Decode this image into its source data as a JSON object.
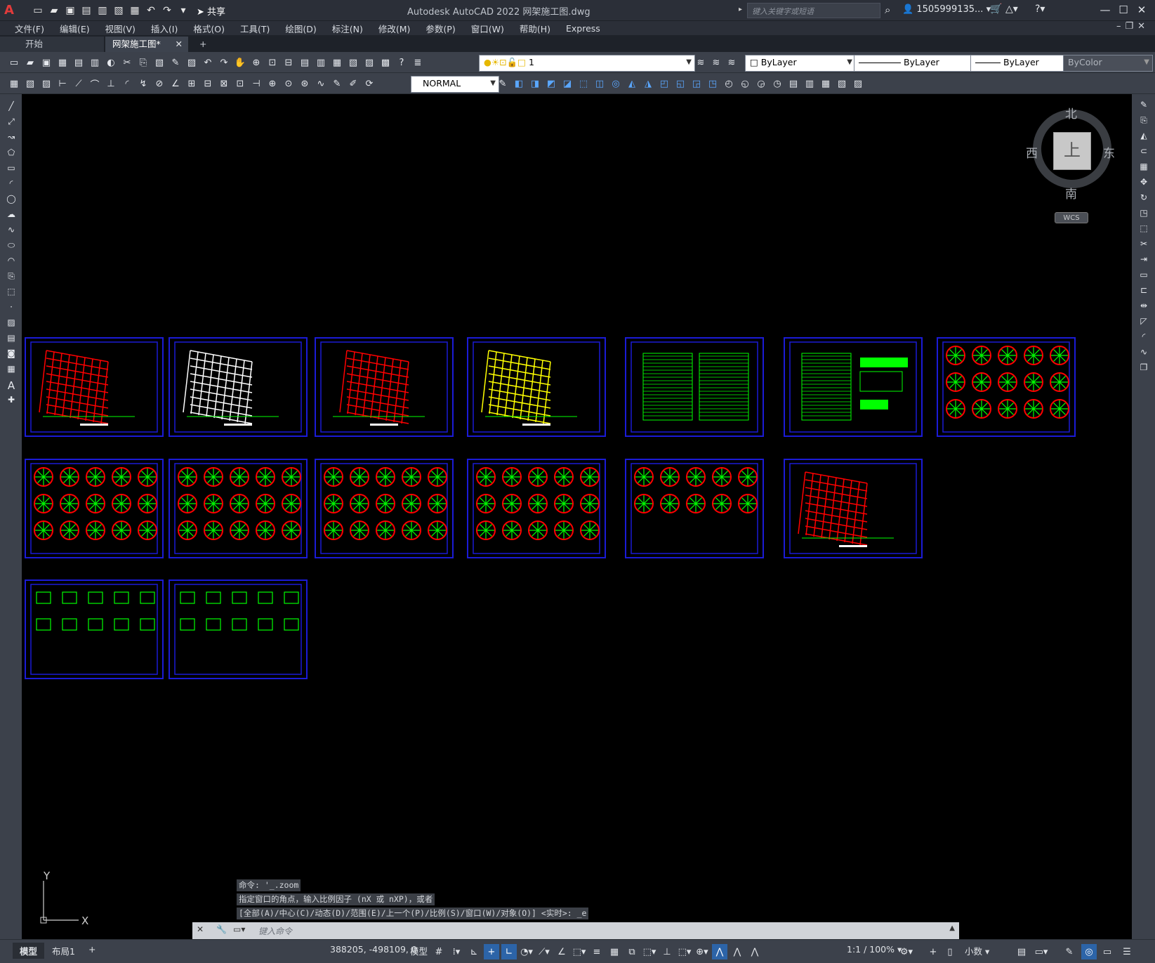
{
  "window": {
    "title": "Autodesk AutoCAD 2022    网架施工图.dwg",
    "search_placeholder": "键入关键字或短语",
    "user": "1505999135...",
    "logo": "A"
  },
  "quick_access": {
    "share_label": "共享",
    "icons": [
      "new-icon",
      "open-icon",
      "save-icon",
      "save-as-icon",
      "web-icon",
      "import-icon",
      "print-icon",
      "undo-icon",
      "redo-icon"
    ]
  },
  "menu": [
    "文件(F)",
    "编辑(E)",
    "视图(V)",
    "插入(I)",
    "格式(O)",
    "工具(T)",
    "绘图(D)",
    "标注(N)",
    "修改(M)",
    "参数(P)",
    "窗口(W)",
    "帮助(H)",
    "Express"
  ],
  "tabs": [
    {
      "label": "开始"
    },
    {
      "label": "网架施工图*",
      "close": "✕"
    },
    {
      "label": "+"
    }
  ],
  "properties": {
    "layer_value": "1",
    "color": "ByLayer",
    "linetype": "ByLayer",
    "lineweight": "ByLayer",
    "plotstyle": "ByColor",
    "dimstyle": "NORMAL"
  },
  "viewcube": {
    "north": "北",
    "south": "南",
    "east": "东",
    "west": "西",
    "face": "上",
    "wcs": "WCS"
  },
  "ucs": {
    "y": "Y",
    "x": "X"
  },
  "command_history": [
    "命令: '_.zoom",
    "指定窗口的角点，输入比例因子 (nX 或 nXP)，或者",
    "[全部(A)/中心(C)/动态(D)/范围(E)/上一个(P)/比例(S)/窗口(W)/对象(O)] <实时>: _e"
  ],
  "command_placeholder": "键入命令",
  "status": {
    "tab_model": "模型",
    "tab_layout": "布局1",
    "add_tab": "+",
    "coords": "388205, -498109, 0",
    "mode": "模型",
    "scale": "1:1 / 100%",
    "units": "小数"
  },
  "colors": {
    "sheet_border": "#1b1bd6",
    "green": "#00ff00",
    "red": "#ff0000",
    "yellow": "#ffff00",
    "white": "#ffffff"
  }
}
